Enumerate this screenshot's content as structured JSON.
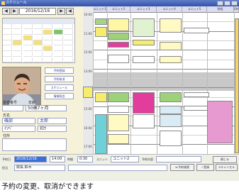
{
  "window": {
    "title": "スケジュール"
  },
  "nav": {
    "prev_label": "◀",
    "next_label": "▶",
    "date": "2016/12/16"
  },
  "side_buttons": [
    "予約登録",
    "予約取消",
    "スケジュール",
    "情報照会"
  ],
  "patient": {
    "id_label": "患者番号",
    "id_value": "",
    "age_label": "年齢",
    "age_value": "50歳7ヶ月",
    "name_label": "氏名",
    "family_kanji": "磯部",
    "given_kanji": "太郎",
    "family_kana": "ｲｿﾍﾞ",
    "given_kana": "ﾀﾛｳ",
    "memo_label": "住所"
  },
  "grid": {
    "times": [
      "10:00",
      "",
      "11:00",
      "",
      "12:00",
      "",
      "13:00",
      "",
      "14:00",
      "",
      "15:00",
      "",
      "16:00",
      "",
      "17:00"
    ],
    "columns": [
      "ユニット1",
      "ユニット2",
      "ユニット3",
      "ユニット4",
      "ユニット5",
      "院長",
      "DH"
    ]
  },
  "bottom": {
    "date_label": "予約日",
    "date_value": "2016/12/16",
    "time_value": "14:00",
    "duration_label": "時間",
    "duration_value": "0:30",
    "unit_label": "ユニット",
    "unit_value": "ユニット2",
    "content_label": "予約内容",
    "staff_label": "担当",
    "staff_value": "院長 鈴木",
    "btn_search": "≫予約検索",
    "btn_register": "✓登録",
    "btn_cancel": "✕キャンセル",
    "btn_close": "閉じる"
  },
  "caption": "予約の変更、取消ができます",
  "colors": {
    "pink": "#e23d9c",
    "yellow": "#f6e84a",
    "green": "#9ccf76",
    "cyan": "#6fd0d8",
    "lilac": "#d6c4e8",
    "orange": "#f0a64a"
  }
}
